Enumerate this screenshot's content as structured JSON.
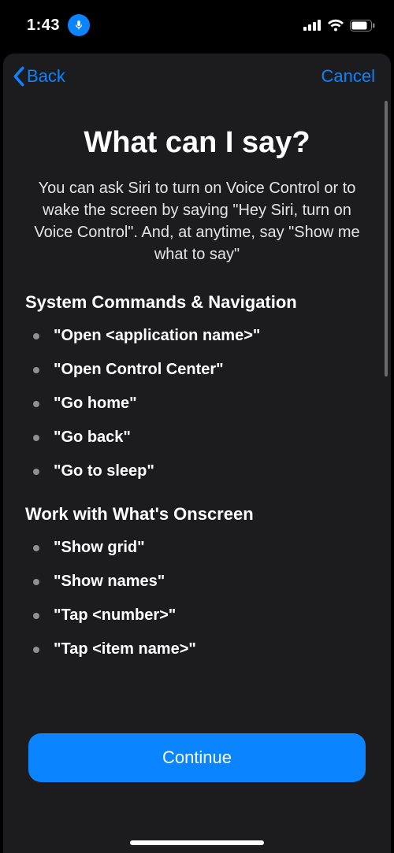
{
  "status": {
    "time": "1:43",
    "mic_active": true
  },
  "nav": {
    "back": "Back",
    "cancel": "Cancel"
  },
  "page": {
    "title": "What can I say?",
    "subtitle": "You can ask Siri to turn on Voice Control or to wake the screen by saying \"Hey Siri, turn on Voice Control\". And, at anytime, say \"Show me what to say\""
  },
  "sections": [
    {
      "heading": "System Commands & Navigation",
      "items": [
        "\"Open <application name>\"",
        "\"Open Control Center\"",
        "\"Go home\"",
        "\"Go back\"",
        "\"Go to sleep\""
      ]
    },
    {
      "heading": "Work with What's Onscreen",
      "items": [
        "\"Show grid\"",
        "\"Show names\"",
        "\"Tap <number>\"",
        "\"Tap <item name>\""
      ]
    }
  ],
  "footer": {
    "continue": "Continue"
  }
}
